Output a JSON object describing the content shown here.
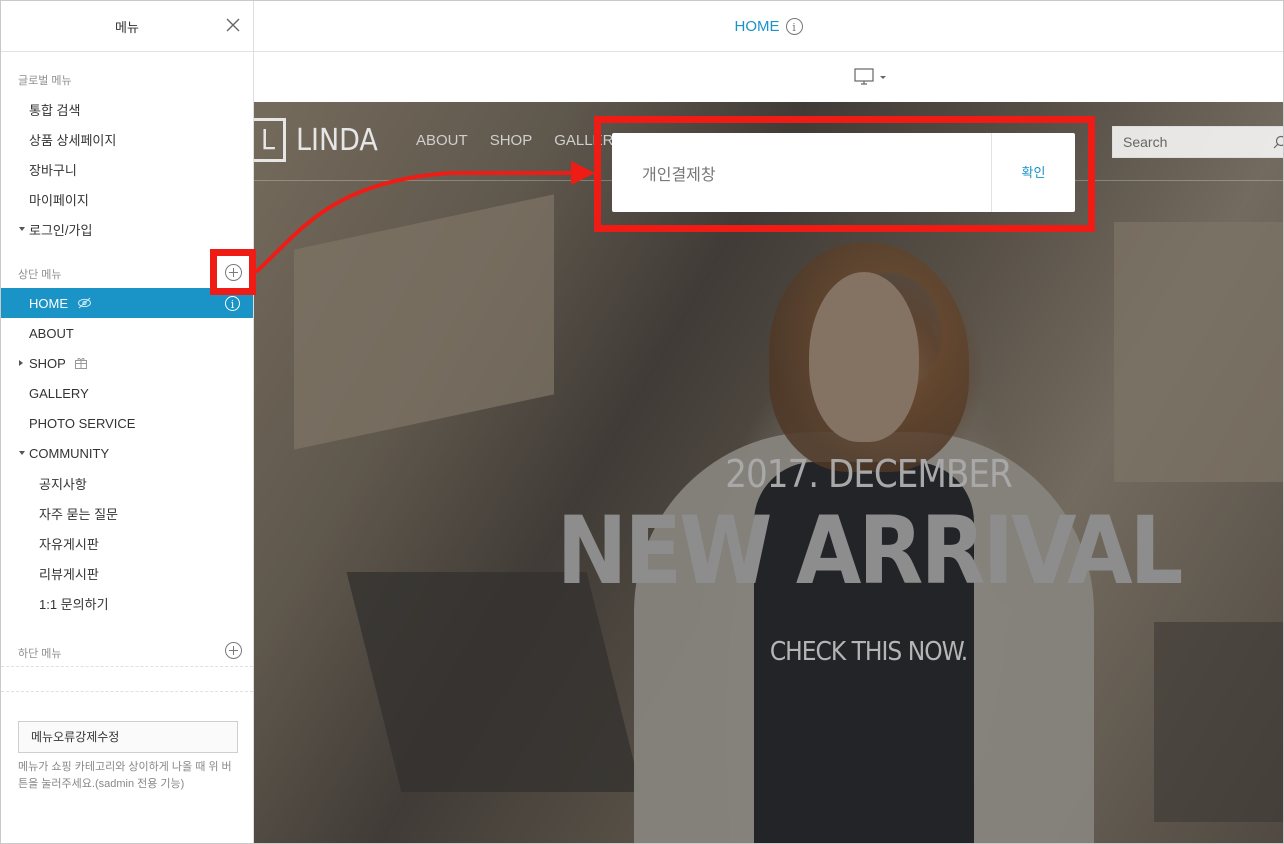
{
  "sidebar": {
    "title": "메뉴",
    "global_menu_label": "글로벌 메뉴",
    "global_items": [
      {
        "label": "통합 검색"
      },
      {
        "label": "상품 상세페이지"
      },
      {
        "label": "장바구니"
      },
      {
        "label": "마이페이지"
      },
      {
        "label": "로그인/가입"
      }
    ],
    "top_menu_label": "상단 메뉴",
    "top_items": [
      {
        "label": "HOME"
      },
      {
        "label": "ABOUT"
      },
      {
        "label": "SHOP"
      },
      {
        "label": "GALLERY"
      },
      {
        "label": "PHOTO SERVICE"
      },
      {
        "label": "COMMUNITY"
      }
    ],
    "community_items": [
      {
        "label": "공지사항"
      },
      {
        "label": "자주 묻는 질문"
      },
      {
        "label": "자유게시판"
      },
      {
        "label": "리뷰게시판"
      },
      {
        "label": "1:1 문의하기"
      }
    ],
    "bottom_menu_label": "하단 메뉴",
    "force_fix_button": "메뉴오류강제수정",
    "note": "메뉴가 쇼핑 카테고리와 상이하게 나올 때 위 버튼을 눌러주세요.(sadmin 전용 기능)"
  },
  "topbar": {
    "page_title": "HOME"
  },
  "site": {
    "logo_letter": "L",
    "logo_text": "LINDA",
    "nav": [
      "ABOUT",
      "SHOP",
      "GALLERY"
    ],
    "search_placeholder": "Search",
    "hero_sub": "2017. DECEMBER",
    "hero_title": "NEW ARRIVAL",
    "hero_cta": "CHECK THIS NOW."
  },
  "modal": {
    "input_value": "개인결제창",
    "confirm_label": "확인"
  },
  "colors": {
    "accent": "#1a93c7",
    "annotation": "#ee1c14"
  }
}
